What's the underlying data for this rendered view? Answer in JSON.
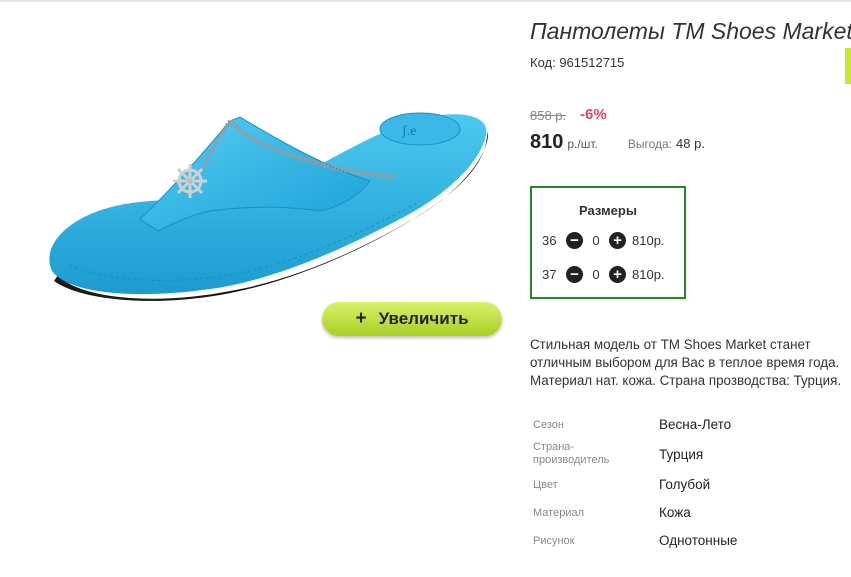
{
  "product": {
    "title": "Пантолеты TM Shoes Market",
    "code": "Код: 961512715",
    "old_price": "858 р.",
    "discount": "-6%",
    "price": "810",
    "price_unit": "р./шт.",
    "benefit_label": "Выгода:",
    "benefit_value": "48 р."
  },
  "zoom_button": {
    "icon": "plus-icon",
    "label": "Увеличить"
  },
  "sizes": {
    "title": "Размеры",
    "rows": [
      {
        "size": "36",
        "qty": "0",
        "price": "810р."
      },
      {
        "size": "37",
        "qty": "0",
        "price": "810р."
      }
    ]
  },
  "description": {
    "line1": "Стильная модель от ТМ Shoes Market станет",
    "line2": "отличным выбором для Вас в теплое время года.",
    "line3": "Материал нат. кожа. Страна прозводства: Турция."
  },
  "attributes": [
    {
      "label": "Сезон",
      "value": "Весна-Лето"
    },
    {
      "label": "Страна-производитель",
      "value": "Турция"
    },
    {
      "label": "Цвет",
      "value": "Голубой"
    },
    {
      "label": "Материал",
      "value": "Кожа"
    },
    {
      "label": "Рисунок",
      "value": "Однотонные"
    }
  ],
  "colors": {
    "accent_green": "#1f8a2a",
    "discount_red": "#e4435f",
    "button_lime": "#b5d82c",
    "sandal_blue": "#2fb6e6"
  }
}
